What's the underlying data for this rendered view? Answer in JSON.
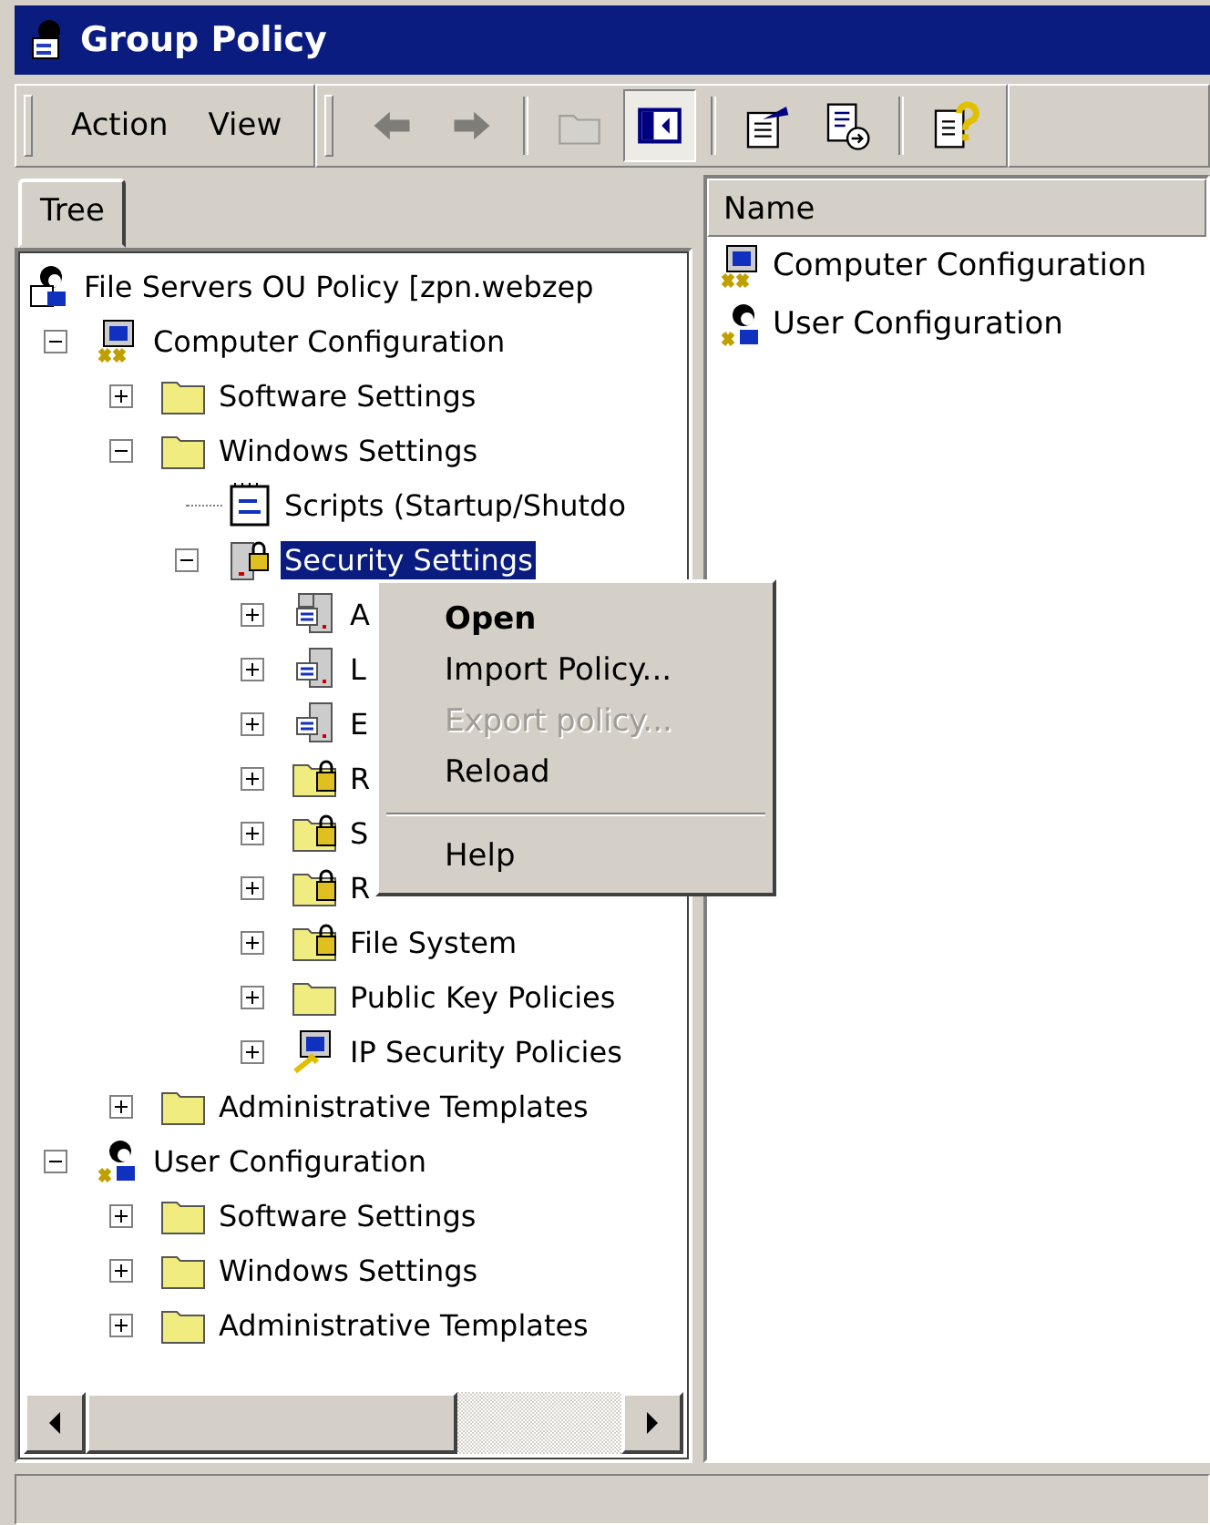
{
  "window": {
    "title": "Group Policy"
  },
  "menu": [
    {
      "label": "Action"
    },
    {
      "label": "View"
    }
  ],
  "toolbar": [
    {
      "kind": "back",
      "disabled": true,
      "pressed": false
    },
    {
      "kind": "forward",
      "disabled": true,
      "pressed": false
    },
    {
      "kind": "up",
      "disabled": true,
      "pressed": false
    },
    {
      "kind": "tree",
      "disabled": false,
      "pressed": true
    },
    {
      "kind": "properties",
      "disabled": false,
      "pressed": false
    },
    {
      "kind": "export",
      "disabled": false,
      "pressed": false
    },
    {
      "kind": "help",
      "disabled": false,
      "pressed": false
    }
  ],
  "tree": {
    "tab": "Tree",
    "nodes": [
      {
        "label": "File Servers OU Policy [zpn.webzep",
        "kind": "policy",
        "selected": false,
        "children": [
          {
            "label": "Computer Configuration",
            "kind": "computer",
            "selected": false,
            "expanded": true,
            "children": [
              {
                "label": "Software Settings",
                "kind": "folder",
                "selected": false,
                "expanded": false
              },
              {
                "label": "Windows Settings",
                "kind": "folder",
                "selected": false,
                "expanded": true,
                "children": [
                  {
                    "label": "Scripts (Startup/Shutdo",
                    "kind": "scripts",
                    "selected": false
                  },
                  {
                    "label": "Security Settings",
                    "kind": "security",
                    "selected": true,
                    "expanded": true,
                    "children": [
                      {
                        "label": "A",
                        "kind": "servers",
                        "selected": false,
                        "expanded": false
                      },
                      {
                        "label": "L",
                        "kind": "server",
                        "selected": false,
                        "expanded": false
                      },
                      {
                        "label": "E",
                        "kind": "server",
                        "selected": false,
                        "expanded": false
                      },
                      {
                        "label": "R",
                        "kind": "lockfolder",
                        "selected": false,
                        "expanded": false
                      },
                      {
                        "label": "S",
                        "kind": "lockfolder",
                        "selected": false,
                        "expanded": false
                      },
                      {
                        "label": "R",
                        "kind": "lockfolder",
                        "selected": false,
                        "expanded": false
                      },
                      {
                        "label": "File System",
                        "kind": "lockfolder",
                        "selected": false,
                        "expanded": false
                      },
                      {
                        "label": "Public Key Policies",
                        "kind": "folder",
                        "selected": false,
                        "expanded": false
                      },
                      {
                        "label": "IP Security Policies",
                        "kind": "ipsec",
                        "selected": false,
                        "expanded": false
                      }
                    ]
                  }
                ]
              },
              {
                "label": "Administrative Templates",
                "kind": "folder",
                "selected": false,
                "expanded": false
              }
            ]
          },
          {
            "label": "User Configuration",
            "kind": "user",
            "selected": false,
            "expanded": true,
            "children": [
              {
                "label": "Software Settings",
                "kind": "folder",
                "selected": false,
                "expanded": false
              },
              {
                "label": "Windows Settings",
                "kind": "folder",
                "selected": false,
                "expanded": false
              },
              {
                "label": "Administrative Templates",
                "kind": "folder",
                "selected": false,
                "expanded": false
              }
            ]
          }
        ]
      }
    ]
  },
  "list": {
    "columns": [
      "Name"
    ],
    "items": [
      {
        "label": "Computer Configuration",
        "kind": "computer"
      },
      {
        "label": "User Configuration",
        "kind": "user"
      }
    ]
  },
  "context_menu": [
    {
      "kind": "item",
      "label": "Open",
      "default": true,
      "disabled": false
    },
    {
      "kind": "item",
      "label": "Import Policy...",
      "default": false,
      "disabled": false
    },
    {
      "kind": "item",
      "label": "Export policy...",
      "default": false,
      "disabled": true
    },
    {
      "kind": "item",
      "label": "Reload",
      "default": false,
      "disabled": false
    },
    {
      "kind": "separator"
    },
    {
      "kind": "item",
      "label": "Help",
      "default": false,
      "disabled": false
    }
  ]
}
